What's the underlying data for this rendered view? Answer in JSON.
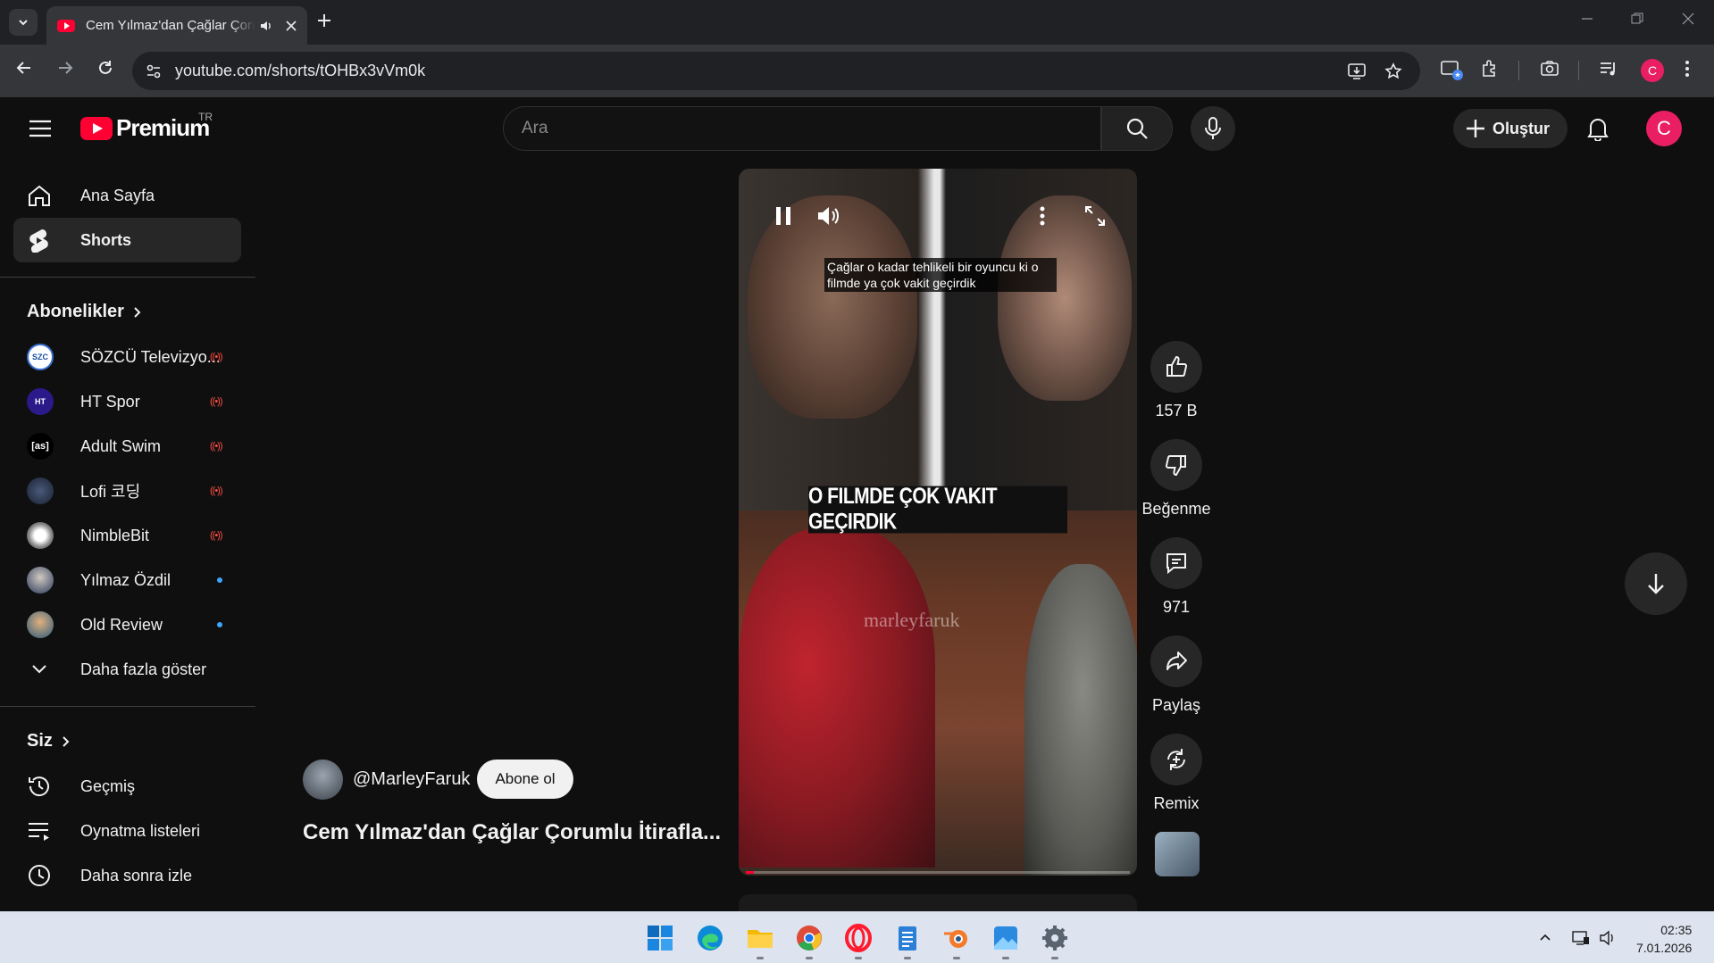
{
  "browser": {
    "tab_title": "Cem Yılmaz'dan Çağlar Çorumlu İtirafları",
    "url": "youtube.com/shorts/tOHBx3vVm0k"
  },
  "header": {
    "logo_text": "Premium",
    "region": "TR",
    "search_placeholder": "Ara",
    "create_label": "Oluştur",
    "avatar_letter": "C"
  },
  "sidebar": {
    "main": [
      {
        "label": "Ana Sayfa",
        "icon": "home-icon"
      },
      {
        "label": "Shorts",
        "icon": "shorts-icon",
        "active": true
      }
    ],
    "subscriptions_title": "Abonelikler",
    "subscriptions": [
      {
        "label": "SÖZCÜ Televizyo...",
        "avatar_text": "SZC",
        "status": "live"
      },
      {
        "label": "HT Spor",
        "avatar_text": "HT",
        "status": "live"
      },
      {
        "label": "Adult Swim",
        "avatar_text": "[as]",
        "status": "live"
      },
      {
        "label": "Lofi 코딩",
        "avatar_text": "",
        "status": "live"
      },
      {
        "label": "NimbleBit",
        "avatar_text": "",
        "status": "live"
      },
      {
        "label": "Yılmaz Özdil",
        "avatar_text": "",
        "status": "new"
      },
      {
        "label": "Old Review",
        "avatar_text": "",
        "status": "new"
      }
    ],
    "show_more": "Daha fazla göster",
    "you_title": "Siz",
    "you_items": [
      {
        "label": "Geçmiş",
        "icon": "history-icon"
      },
      {
        "label": "Oynatma listeleri",
        "icon": "playlists-icon"
      },
      {
        "label": "Daha sonra izle",
        "icon": "watch-later-icon"
      }
    ]
  },
  "video": {
    "caption_top": "Çağlar o kadar tehlikeli bir oyuncu ki o filmde ya çok vakit geçirdik",
    "caption_banner": "O FILMDE ÇOK VAKIT GEÇIRDIK",
    "watermark": "marleyfaruk",
    "progress": 0.02,
    "channel": "@MarleyFaruk",
    "subscribe_label": "Abone ol",
    "title": "Cem Yılmaz'dan Çağlar Çorumlu İtirafla..."
  },
  "actions": {
    "like_count": "157 B",
    "dislike_label": "Beğenme",
    "comment_count": "971",
    "share_label": "Paylaş",
    "remix_label": "Remix"
  },
  "taskbar": {
    "time": "02:35",
    "date": "7.01.2026"
  },
  "colors": {
    "brand": "#ff0033",
    "background": "#0f0f0f",
    "live": "#ff4e45",
    "new_dot": "#3ea6ff"
  }
}
